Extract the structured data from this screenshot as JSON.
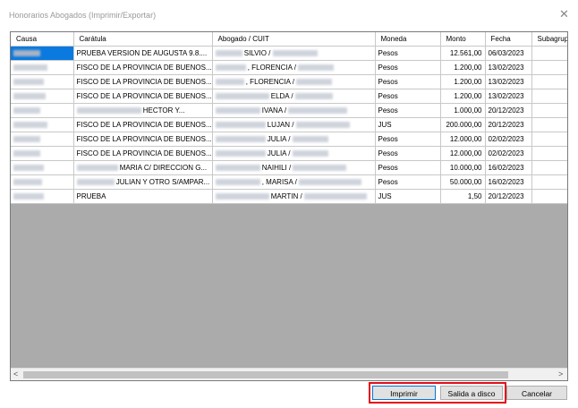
{
  "window": {
    "title": "Honorarios Abogados (Imprimir/Exportar)"
  },
  "columns": [
    "Causa",
    "Carátula",
    "Abogado / CUIT",
    "Moneda",
    "Monto",
    "Fecha",
    "Subagrupa"
  ],
  "rows": [
    {
      "caratula": "PRUEBA VERSION DE AUGUSTA 9.8....",
      "abogado": "SILVIO /",
      "moneda": "Pesos",
      "monto": "12.561,00",
      "fecha": "06/03/2023"
    },
    {
      "caratula": "FISCO DE LA PROVINCIA DE BUENOS...",
      "abogado": ", FLORENCIA /",
      "moneda": "Pesos",
      "monto": "1.200,00",
      "fecha": "13/02/2023"
    },
    {
      "caratula": "FISCO DE LA PROVINCIA DE BUENOS...",
      "abogado": ", FLORENCIA /",
      "moneda": "Pesos",
      "monto": "1.200,00",
      "fecha": "13/02/2023"
    },
    {
      "caratula": "FISCO DE LA PROVINCIA DE BUENOS...",
      "abogado": "ELDA /",
      "moneda": "Pesos",
      "monto": "1.200,00",
      "fecha": "13/02/2023"
    },
    {
      "caratula": "HECTOR Y...",
      "abogado": "IVANA /",
      "moneda": "Pesos",
      "monto": "1.000,00",
      "fecha": "20/12/2023"
    },
    {
      "caratula": "FISCO DE LA PROVINCIA DE BUENOS...",
      "abogado": "LUJAN /",
      "moneda": "JUS",
      "monto": "200.000,00",
      "fecha": "20/12/2023"
    },
    {
      "caratula": "FISCO DE LA PROVINCIA DE BUENOS...",
      "abogado": "JULIA /",
      "moneda": "Pesos",
      "monto": "12.000,00",
      "fecha": "02/02/2023"
    },
    {
      "caratula": "FISCO DE LA PROVINCIA DE BUENOS...",
      "abogado": "JULIA /",
      "moneda": "Pesos",
      "monto": "12.000,00",
      "fecha": "02/02/2023"
    },
    {
      "caratula": "MARIA C/ DIRECCION G...",
      "abogado": "NAIHILI /",
      "moneda": "Pesos",
      "monto": "10.000,00",
      "fecha": "16/02/2023"
    },
    {
      "caratula": "JULIAN Y OTRO S/AMPAR...",
      "abogado": ", MARISA /",
      "moneda": "Pesos",
      "monto": "50.000,00",
      "fecha": "16/02/2023"
    },
    {
      "caratula": "PRUEBA",
      "abogado": "MARTIN /",
      "moneda": "JUS",
      "monto": "1,50",
      "fecha": "20/12/2023"
    }
  ],
  "buttons": {
    "imprimir": "Imprimir",
    "salida": "Salida a disco",
    "cancelar": "Cancelar"
  },
  "scrollbar": {
    "left_arrow": "<",
    "right_arrow": ">"
  },
  "icons": {
    "close": "close-icon"
  },
  "colors": {
    "selection": "#0a7ae0",
    "highlight_border": "#e0101a"
  }
}
